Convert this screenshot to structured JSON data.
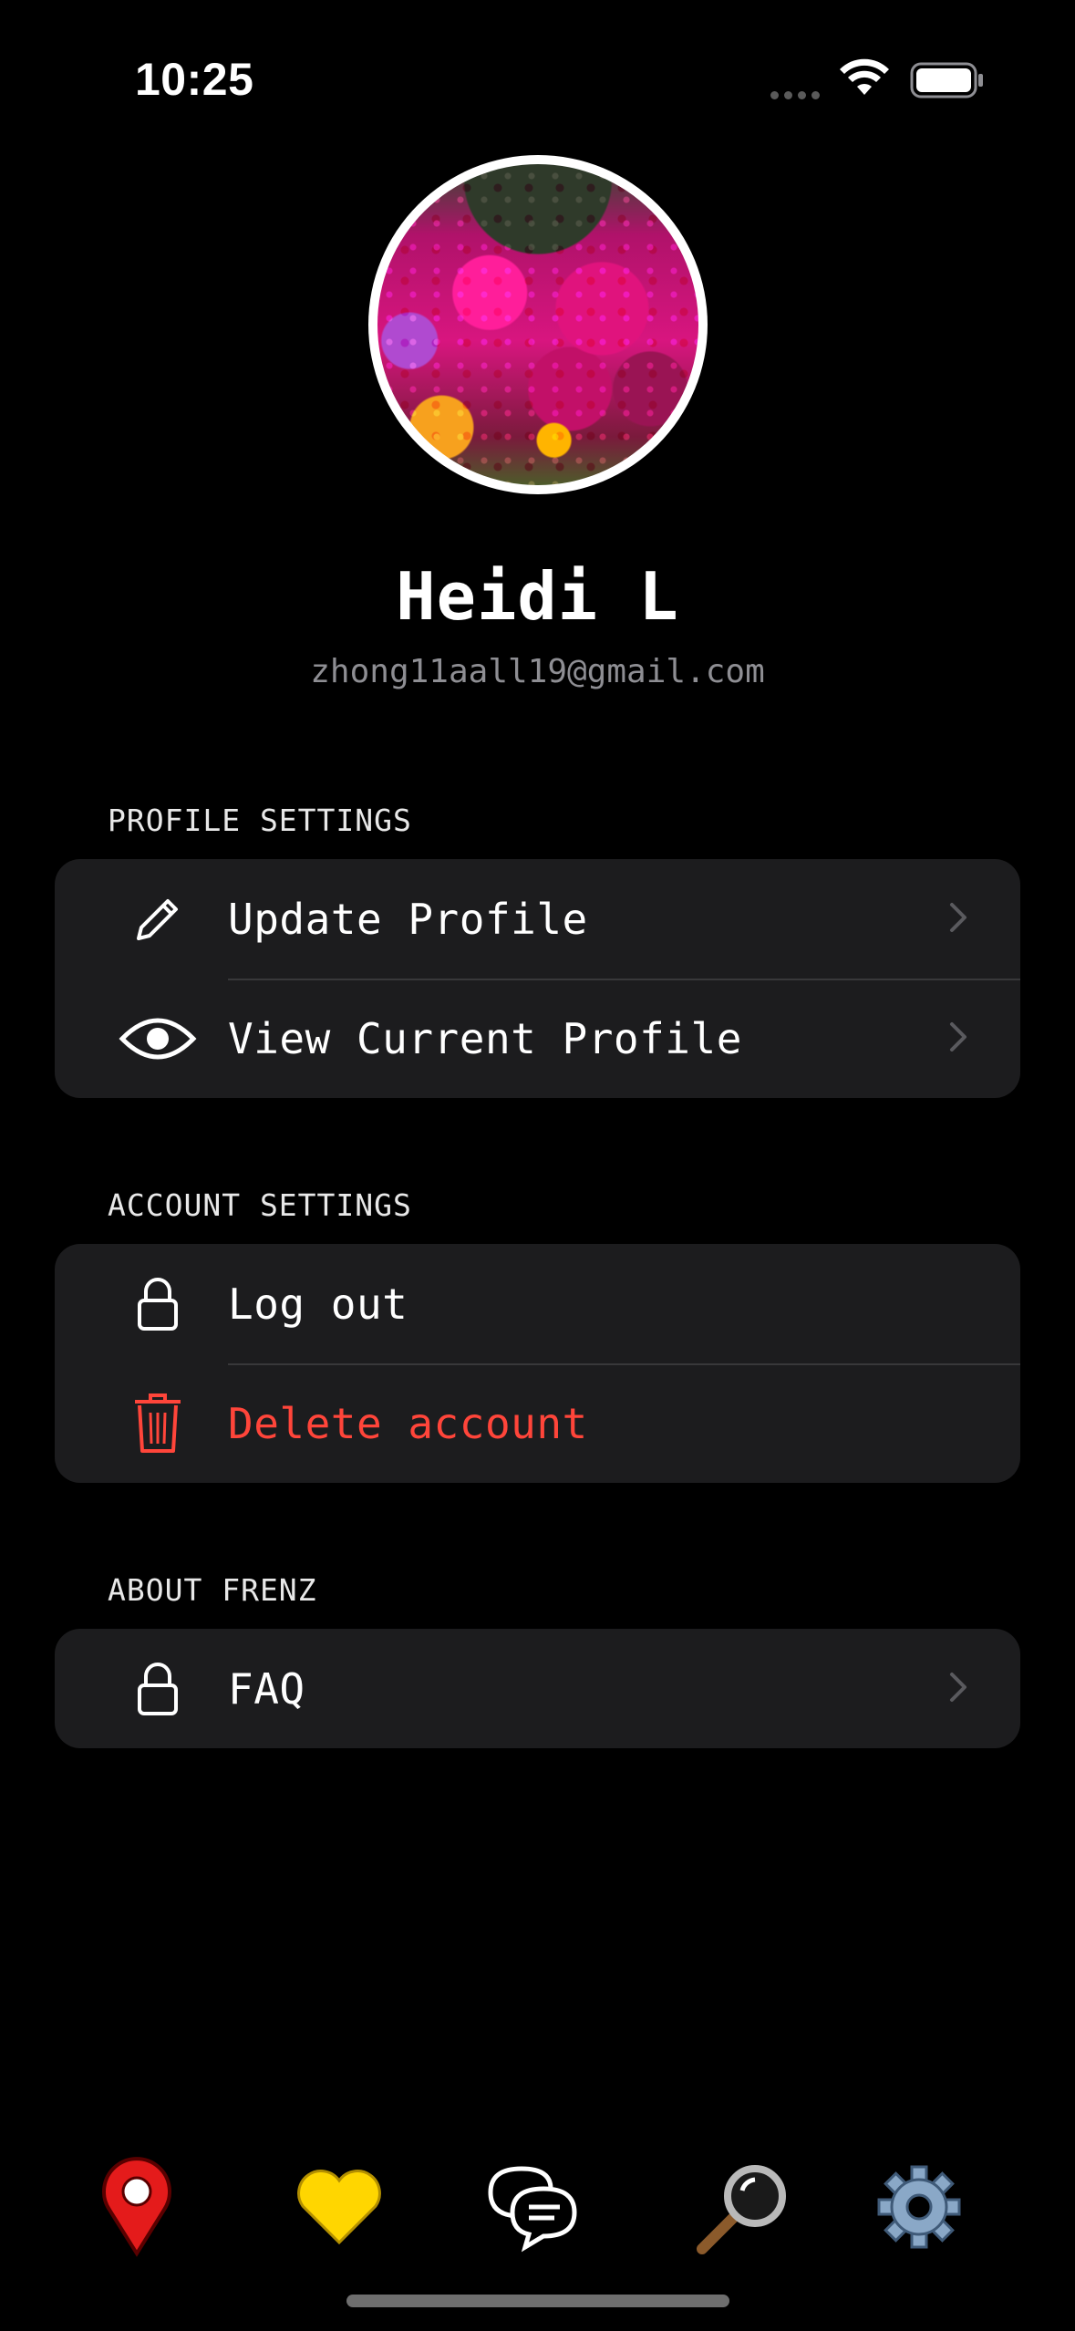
{
  "status_bar": {
    "time": "10:25"
  },
  "profile": {
    "name": "Heidi L",
    "email": "zhong11aall19@gmail.com"
  },
  "sections": {
    "profile_settings": {
      "title": "PROFILE SETTINGS",
      "items": [
        {
          "label": "Update Profile",
          "icon": "pencil-icon"
        },
        {
          "label": "View Current Profile",
          "icon": "eye-icon"
        }
      ]
    },
    "account_settings": {
      "title": "ACCOUNT SETTINGS",
      "items": [
        {
          "label": "Log out",
          "icon": "lock-icon"
        },
        {
          "label": "Delete account",
          "icon": "trash-icon"
        }
      ]
    },
    "about": {
      "title": "ABOUT FRENZ",
      "items": [
        {
          "label": "FAQ",
          "icon": "lock-icon"
        }
      ]
    }
  },
  "tab_bar": [
    {
      "icon": "map-pin-icon"
    },
    {
      "icon": "heart-icon"
    },
    {
      "icon": "chat-icon"
    },
    {
      "icon": "magnifier-icon"
    },
    {
      "icon": "gear-icon"
    }
  ],
  "colors": {
    "background": "#000000",
    "card": "#1c1c1e",
    "danger": "#ff453a",
    "secondary_text": "#8e8e93"
  }
}
